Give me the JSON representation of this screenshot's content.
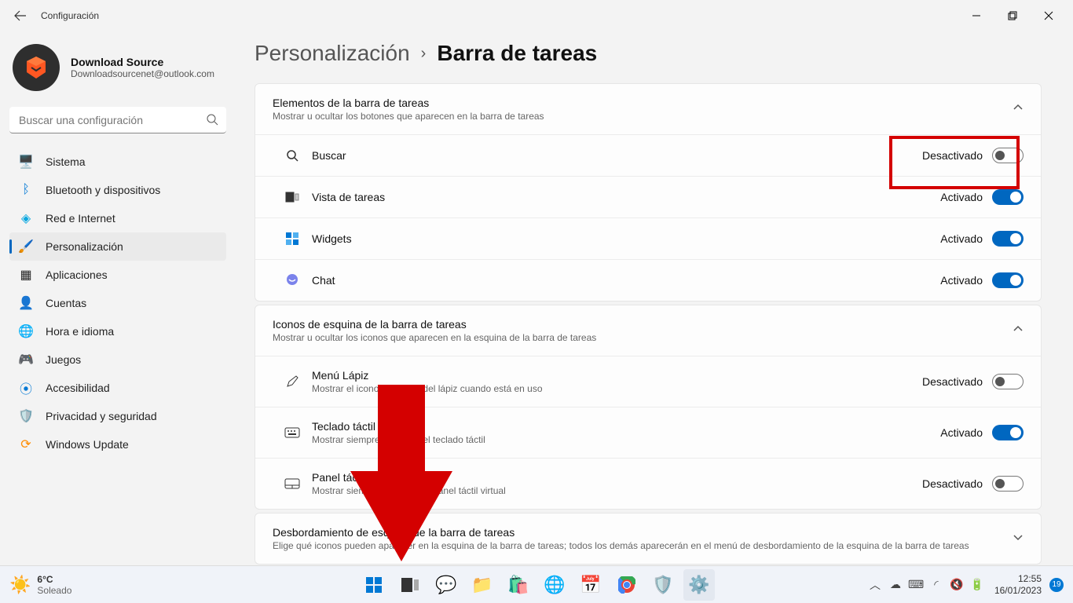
{
  "window": {
    "back": "←",
    "title": "Configuración"
  },
  "account": {
    "name": "Download Source",
    "email": "Downloadsourcenet@outlook.com"
  },
  "search": {
    "placeholder": "Buscar una configuración"
  },
  "nav": {
    "system": "Sistema",
    "bluetooth": "Bluetooth y dispositivos",
    "network": "Red e Internet",
    "personalization": "Personalización",
    "apps": "Aplicaciones",
    "accounts": "Cuentas",
    "time": "Hora e idioma",
    "gaming": "Juegos",
    "accessibility": "Accesibilidad",
    "privacy": "Privacidad y seguridad",
    "update": "Windows Update"
  },
  "crumb": {
    "parent": "Personalización",
    "sep": "›",
    "current": "Barra de tareas"
  },
  "section1": {
    "title": "Elementos de la barra de tareas",
    "subtitle": "Mostrar u ocultar los botones que aparecen en la barra de tareas",
    "rows": {
      "search": {
        "label": "Buscar",
        "state": "Desactivado"
      },
      "taskview": {
        "label": "Vista de tareas",
        "state": "Activado"
      },
      "widgets": {
        "label": "Widgets",
        "state": "Activado"
      },
      "chat": {
        "label": "Chat",
        "state": "Activado"
      }
    }
  },
  "section2": {
    "title": "Iconos de esquina de la barra de tareas",
    "subtitle": "Mostrar u ocultar los iconos que aparecen en la esquina de la barra de tareas",
    "rows": {
      "pen": {
        "label": "Menú Lápiz",
        "sub": "Mostrar el icono del menú del lápiz cuando está en uso",
        "state": "Desactivado"
      },
      "touchkbd": {
        "label": "Teclado táctil",
        "sub": "Mostrar siempre el icono del teclado táctil",
        "state": "Activado"
      },
      "touchpad": {
        "label": "Panel táctil",
        "sub": "Mostrar siempre el icono del panel táctil virtual",
        "state": "Desactivado"
      }
    }
  },
  "section3": {
    "title": "Desbordamiento de esquina de la barra de tareas",
    "subtitle": "Elige qué iconos pueden aparecer en la esquina de la barra de tareas; todos los demás aparecerán en el menú de desbordamiento de la esquina de la barra de tareas"
  },
  "taskbar": {
    "weather": {
      "temp": "6°C",
      "desc": "Soleado"
    },
    "clock": {
      "time": "12:55",
      "date": "16/01/2023"
    },
    "badge": "19"
  }
}
